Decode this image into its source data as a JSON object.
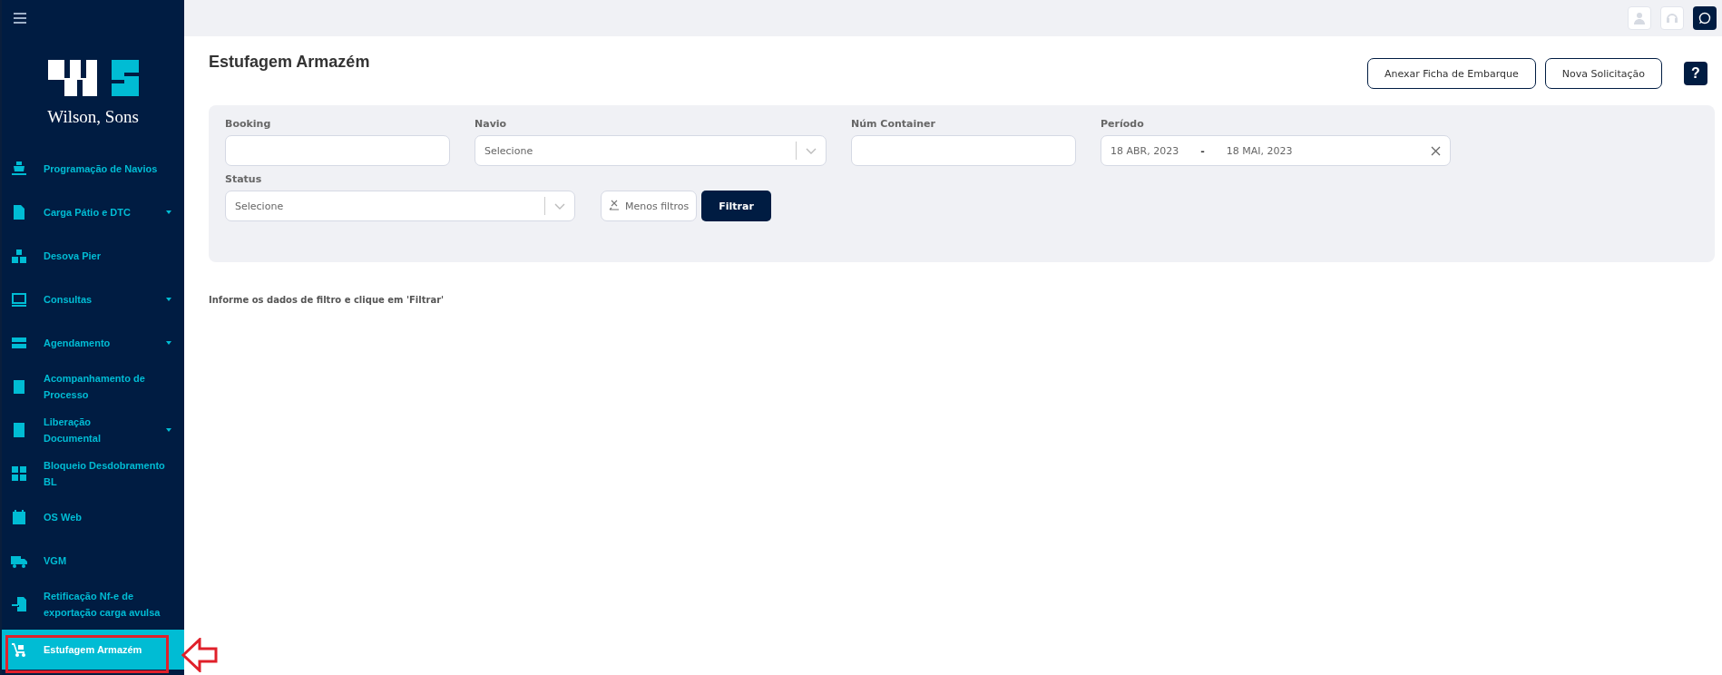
{
  "sidebar": {
    "logo_text": "Wilson, Sons",
    "items": [
      {
        "label": "Programação de Navios",
        "has_submenu": false,
        "selected": false
      },
      {
        "label": "Carga Pátio e DTC",
        "has_submenu": true,
        "selected": false
      },
      {
        "label": "Desova Pier",
        "has_submenu": false,
        "selected": false
      },
      {
        "label": "Consultas",
        "has_submenu": true,
        "selected": false
      },
      {
        "label": "Agendamento",
        "has_submenu": true,
        "selected": false
      },
      {
        "label": "Acompanhamento de Processo",
        "has_submenu": false,
        "selected": false
      },
      {
        "label": "Liberação Documental",
        "has_submenu": true,
        "selected": false
      },
      {
        "label": "Bloqueio Desdobramento BL",
        "has_submenu": false,
        "selected": false
      },
      {
        "label": "OS Web",
        "has_submenu": false,
        "selected": false
      },
      {
        "label": "VGM",
        "has_submenu": false,
        "selected": false
      },
      {
        "label": "Retificação Nf-e de exportação carga avulsa",
        "has_submenu": false,
        "selected": false
      },
      {
        "label": "Estufagem Armazém",
        "has_submenu": false,
        "selected": true
      }
    ]
  },
  "page": {
    "title": "Estufagem Armazém",
    "buttons": [
      "Anexar Ficha de Embarque",
      "Nova Solicitação"
    ],
    "help": "?"
  },
  "filters": {
    "booking": {
      "label": "Booking"
    },
    "navio": {
      "label": "Navio",
      "placeholder": "Selecione"
    },
    "container": {
      "label": "Núm Container"
    },
    "periodo": {
      "label": "Período",
      "start": "18 ABR, 2023",
      "separator": "-",
      "end": "18 MAI, 2023"
    },
    "status": {
      "label": "Status",
      "placeholder": "Selecione"
    },
    "less_filters": "Menos filtros",
    "apply": "Filtrar"
  },
  "message": "Informe os dados de filtro e clique em 'Filtrar'"
}
